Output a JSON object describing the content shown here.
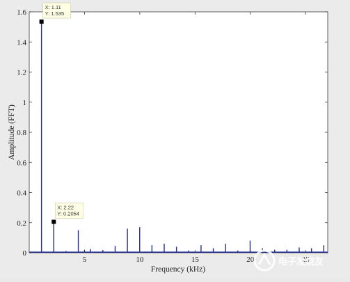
{
  "chart_data": {
    "type": "bar",
    "title": "",
    "xlabel": "Frequency (kHz)",
    "ylabel": "Amplitude (FFT)",
    "xlim": [
      0,
      27
    ],
    "ylim": [
      0,
      1.6
    ],
    "xticks": [
      5,
      10,
      15,
      20,
      25
    ],
    "xtick_labels": [
      "5",
      "10",
      "15",
      "20",
      "25"
    ],
    "yticks": [
      0,
      0.2,
      0.4,
      0.6,
      0.8,
      1,
      1.2,
      1.4,
      1.6
    ],
    "ytick_labels": [
      "0",
      "0.2",
      "0.4",
      "0.6",
      "0.8",
      "1",
      "1.2",
      "1.4",
      "1.6"
    ],
    "grid": false,
    "series": [
      {
        "color": "#1f2f8f",
        "x": [
          1.11,
          2.22,
          3.33,
          4.44,
          5.0,
          5.55,
          6.66,
          7.77,
          8.88,
          9.99,
          11.1,
          12.21,
          13.32,
          14.43,
          15.54,
          16.65,
          17.76,
          18.87,
          19.98,
          21.09,
          22.2,
          23.31,
          24.42,
          25.53,
          26.64
        ],
        "y": [
          1.535,
          0.2054,
          0.012,
          0.15,
          0.02,
          0.025,
          0.018,
          0.045,
          0.16,
          0.17,
          0.05,
          0.06,
          0.04,
          0.015,
          0.05,
          0.03,
          0.06,
          0.015,
          0.08,
          0.03,
          0.02,
          0.02,
          0.035,
          0.03,
          0.05
        ]
      }
    ],
    "annotations": [
      {
        "x_label": "X: 1.11",
        "y_label": "Y: 1.535",
        "x": 1.11,
        "y": 1.535
      },
      {
        "x_label": "X: 2.22",
        "y_label": "Y: 0.2054",
        "x": 2.22,
        "y": 0.2054
      }
    ]
  },
  "watermark": {
    "text": "电子发烧友"
  }
}
